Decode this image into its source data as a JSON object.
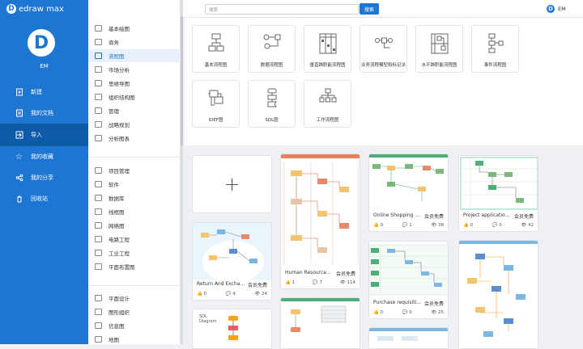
{
  "app": {
    "brand": "edraw max",
    "logo_letter": "D",
    "user_initials": "EM",
    "user_name": "EM"
  },
  "sidebar": {
    "items": [
      {
        "label": "新建",
        "icon": "new-file-icon"
      },
      {
        "label": "我的文档",
        "icon": "documents-icon"
      },
      {
        "label": "导入",
        "icon": "import-icon"
      },
      {
        "label": "我的收藏",
        "icon": "star-icon"
      },
      {
        "label": "我的分享",
        "icon": "share-icon"
      },
      {
        "label": "回收站",
        "icon": "trash-icon"
      }
    ]
  },
  "categories": {
    "group1": [
      "基本绘图",
      "商务",
      "流程图",
      "市场分析",
      "思维导图",
      "组织结构图",
      "管理",
      "战略规划",
      "分析图表"
    ],
    "group2": [
      "项目管理",
      "软件",
      "数据库",
      "线框图",
      "网络图",
      "电路工程",
      "工业工程",
      "平面布置图"
    ],
    "group3": [
      "平面设计",
      "图形组织",
      "信息图",
      "地图"
    ],
    "selected": "流程图"
  },
  "search": {
    "placeholder": "搜索",
    "button": "搜索"
  },
  "templates": [
    {
      "label": "基本流程图"
    },
    {
      "label": "数据流程图"
    },
    {
      "label": "垂直跨职能流程图"
    },
    {
      "label": "业务流程模型和标记法"
    },
    {
      "label": "水平跨职能流程图"
    },
    {
      "label": "事件流程图"
    },
    {
      "label": "IDEF图"
    },
    {
      "label": "SDL图"
    },
    {
      "label": "工作流程图"
    }
  ],
  "gallery": {
    "badge": "会员免费",
    "cards": [
      {
        "title": "Return And Excha...",
        "likes": "0",
        "comments": "4",
        "views": "24"
      },
      {
        "title": "Human Resource...",
        "likes": "1",
        "comments": "7",
        "views": "114"
      },
      {
        "title": "Online Shopping ...",
        "likes": "0",
        "comments": "1",
        "views": "38"
      },
      {
        "title": "Project applicatio...",
        "likes": "0",
        "comments": "0",
        "views": "42"
      },
      {
        "title": "Purchase requisiti...",
        "likes": "0",
        "comments": "0",
        "views": "25"
      }
    ],
    "partial_text": [
      "SDL",
      "Diagram"
    ]
  },
  "colors": {
    "primary": "#1d76d2",
    "active_nav": "#0d5aa7",
    "orange_header": "#e8825a",
    "green_header": "#4caf78"
  }
}
